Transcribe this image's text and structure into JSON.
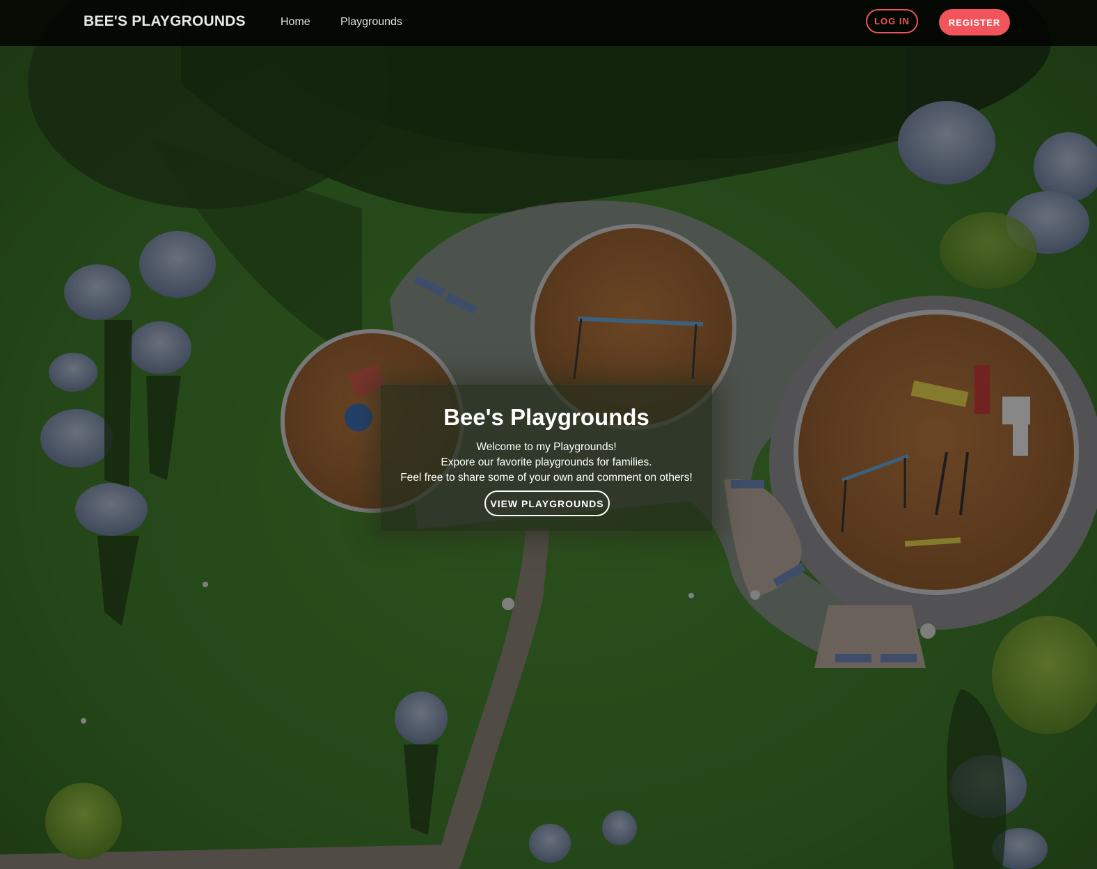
{
  "navbar": {
    "brand": "BEE'S PLAYGROUNDS",
    "links": [
      {
        "label": "Home"
      },
      {
        "label": "Playgrounds"
      }
    ],
    "login_label": "LOG IN",
    "register_label": "REGISTER"
  },
  "hero": {
    "title": "Bee's Playgrounds",
    "lines": [
      "Welcome to my Playgrounds!",
      "Expore our favorite playgrounds for families.",
      "Feel free to share some of your own and comment on others!"
    ],
    "button_label": "VIEW PLAYGROUNDS"
  },
  "colors": {
    "accent": "#f2545b",
    "navbar_bg": "#0b0b0b",
    "grass": "#3f6e2a",
    "mulch": "#a06a3a"
  }
}
